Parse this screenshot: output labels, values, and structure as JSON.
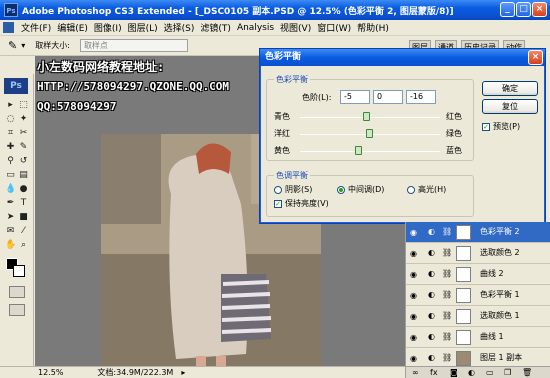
{
  "window": {
    "title": "Adobe Photoshop CS3 Extended - [_DSC0105 副本.PSD @ 12.5% (色彩平衡 2, 图层蒙版/8)]",
    "ps_badge": "Ps"
  },
  "menu": [
    "文件(F)",
    "编辑(E)",
    "图像(I)",
    "图层(L)",
    "选择(S)",
    "滤镜(T)",
    "Analysis",
    "视图(V)",
    "窗口(W)",
    "帮助(H)"
  ],
  "options": {
    "sample_size_label": "取样大小:",
    "sample_size_value": "取样点"
  },
  "palette_tabs": [
    "图层",
    "通道",
    "历史记录",
    "动作"
  ],
  "watermark": {
    "line1": "小左数码网络教程地址:",
    "line2": "HTTP://578094297.QZONE.QQ.COM",
    "line3": "QQ:578094297"
  },
  "status": {
    "zoom": "12.5%",
    "doc": "文档:34.9M/222.3M"
  },
  "dialog": {
    "title": "色彩平衡",
    "balance_group": "色彩平衡",
    "levels_label": "色阶(L):",
    "levels": [
      "-5",
      "0",
      "-16"
    ],
    "sliders": [
      {
        "left": "青色",
        "right": "红色",
        "value": -5
      },
      {
        "left": "洋红",
        "right": "绿色",
        "value": 0
      },
      {
        "left": "黄色",
        "right": "蓝色",
        "value": -16
      }
    ],
    "tone_group": "色调平衡",
    "tones": [
      "阴影(S)",
      "中间调(D)",
      "高光(H)"
    ],
    "tone_selected": 1,
    "preserve_luminosity": "保持亮度(V)",
    "ok": "确定",
    "reset": "复位",
    "preview": "预览(P)"
  },
  "layers": [
    {
      "name": "色彩平衡 2",
      "selected": true
    },
    {
      "name": "选取颜色 2",
      "selected": false
    },
    {
      "name": "曲线 2",
      "selected": false
    },
    {
      "name": "色彩平衡 1",
      "selected": false
    },
    {
      "name": "选取颜色 1",
      "selected": false
    },
    {
      "name": "曲线 1",
      "selected": false
    },
    {
      "name": "图层 1 副本",
      "selected": false
    }
  ],
  "colors": {
    "titlebar": "#0a5ce0",
    "selected_layer": "#316ac5",
    "dialog_group_label": "#1a4ab4"
  }
}
